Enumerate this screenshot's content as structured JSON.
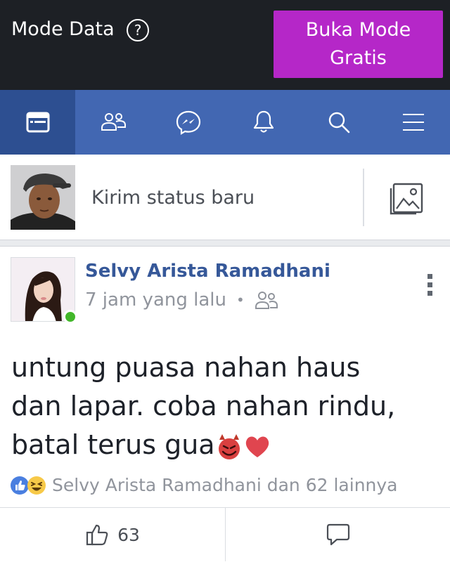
{
  "data_mode": {
    "label": "Mode Data",
    "help_icon": "help-circle-icon",
    "free_mode_button": "Buka Mode Gratis",
    "button_color": "#b527c8"
  },
  "nav": {
    "color": "#4267b2",
    "active_color": "#2d4f91",
    "items": [
      {
        "icon": "news-feed-icon",
        "active": true
      },
      {
        "icon": "friends-icon",
        "active": false
      },
      {
        "icon": "messenger-icon",
        "active": false
      },
      {
        "icon": "notifications-bell-icon",
        "active": false
      },
      {
        "icon": "search-icon",
        "active": false
      },
      {
        "icon": "menu-icon",
        "active": false
      }
    ]
  },
  "composer": {
    "placeholder": "Kirim status baru",
    "photo_icon": "photo-icon"
  },
  "post": {
    "author": "Selvy Arista Ramadhani",
    "time": "7 jam yang lalu",
    "separator": "•",
    "audience_icon": "friends-audience-icon",
    "text_line1": "untung puasa nahan haus",
    "text_line2": "dan lapar. coba nahan rindu,",
    "text_line3": "batal terus gua",
    "emojis": [
      "smiling-devil-emoji",
      "red-heart-emoji"
    ],
    "reactions_text": "Selvy Arista Ramadhani dan 62 lainnya",
    "reaction_icons": [
      "like-reaction-icon",
      "haha-reaction-icon"
    ],
    "like_count": "63",
    "online": true
  }
}
